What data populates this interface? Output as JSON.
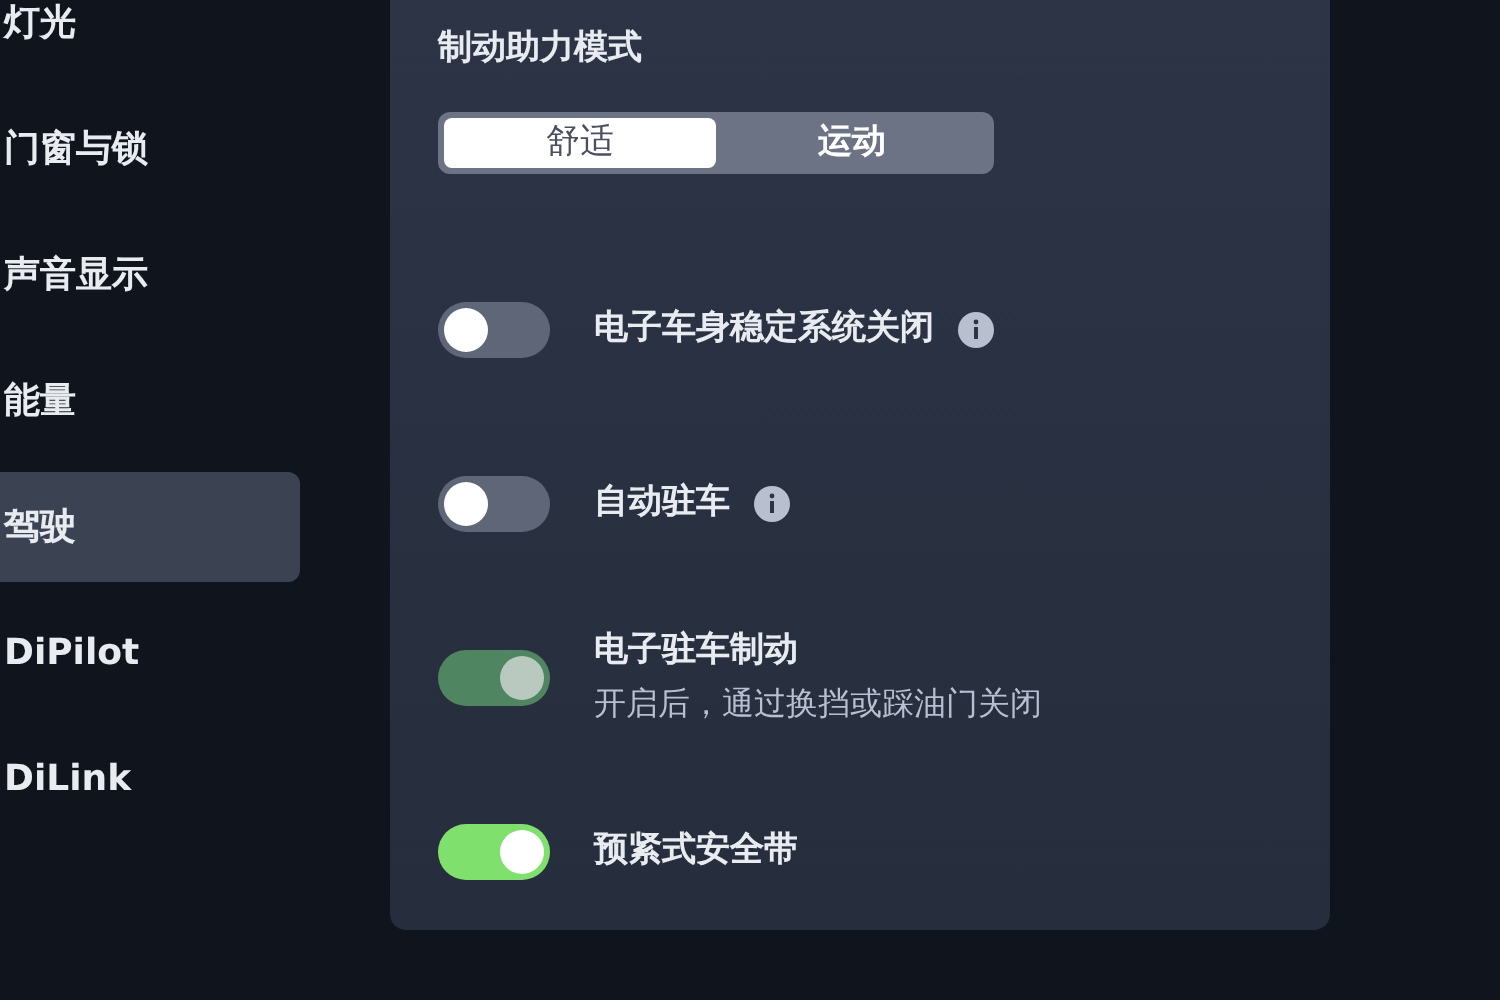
{
  "sidebar": {
    "items": [
      {
        "label": "灯光",
        "selected": false
      },
      {
        "label": "门窗与锁",
        "selected": false
      },
      {
        "label": "声音显示",
        "selected": false
      },
      {
        "label": "能量",
        "selected": false
      },
      {
        "label": "驾驶",
        "selected": true
      },
      {
        "label": "DiPilot",
        "selected": false
      },
      {
        "label": "DiLink",
        "selected": false
      }
    ]
  },
  "panel": {
    "title": "制动助力模式",
    "segments": [
      {
        "label": "舒适",
        "selected": true
      },
      {
        "label": "运动",
        "selected": false
      }
    ],
    "settings": [
      {
        "label": "电子车身稳定系统关闭",
        "on": false,
        "disabled": false,
        "info": true
      },
      {
        "label": "自动驻车",
        "on": false,
        "disabled": false,
        "info": true
      },
      {
        "label": "电子驻车制动",
        "subtitle": "开启后，通过换挡或踩油门关闭",
        "on": true,
        "disabled": true,
        "info": false
      },
      {
        "label": "预紧式安全带",
        "on": true,
        "disabled": false,
        "info": false
      }
    ]
  }
}
